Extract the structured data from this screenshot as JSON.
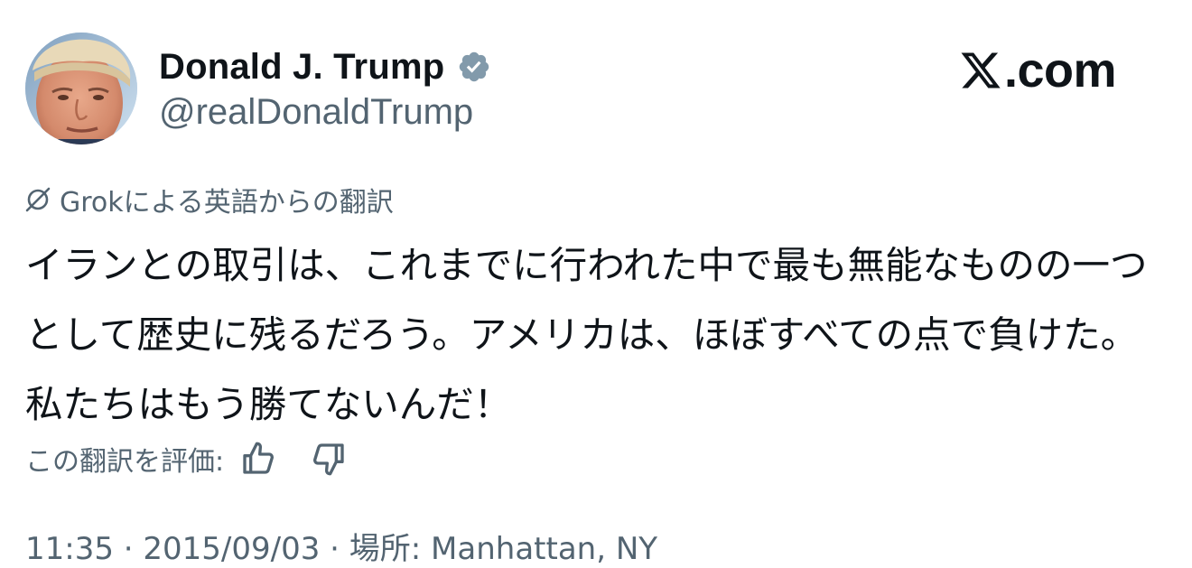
{
  "author": {
    "display_name": "Donald J. Trump",
    "handle": "@realDonaldTrump",
    "verified_badge": "verified-badge-icon",
    "avatar": "profile-photo"
  },
  "brand": {
    "logo": "x-logo-icon",
    "text": ".com"
  },
  "translation": {
    "icon": "grok-icon",
    "note": "Grokによる英語からの翻訳"
  },
  "tweet": {
    "text": "イランとの取引は、これまでに行われた中で最も無能なものの一つとして歴史に残るだろう。アメリカは、ほぼすべての点で負けた。私たちはもう勝てないんだ！"
  },
  "rating": {
    "label": "この翻訳を評価:",
    "up_icon": "thumbs-up-icon",
    "down_icon": "thumbs-down-icon"
  },
  "meta": {
    "text": "11:35 · 2015/09/03 · 場所: Manhattan, NY"
  },
  "colors": {
    "primary_text": "#0f1419",
    "secondary_text": "#536471",
    "badge": "#829aab",
    "background": "#ffffff"
  }
}
